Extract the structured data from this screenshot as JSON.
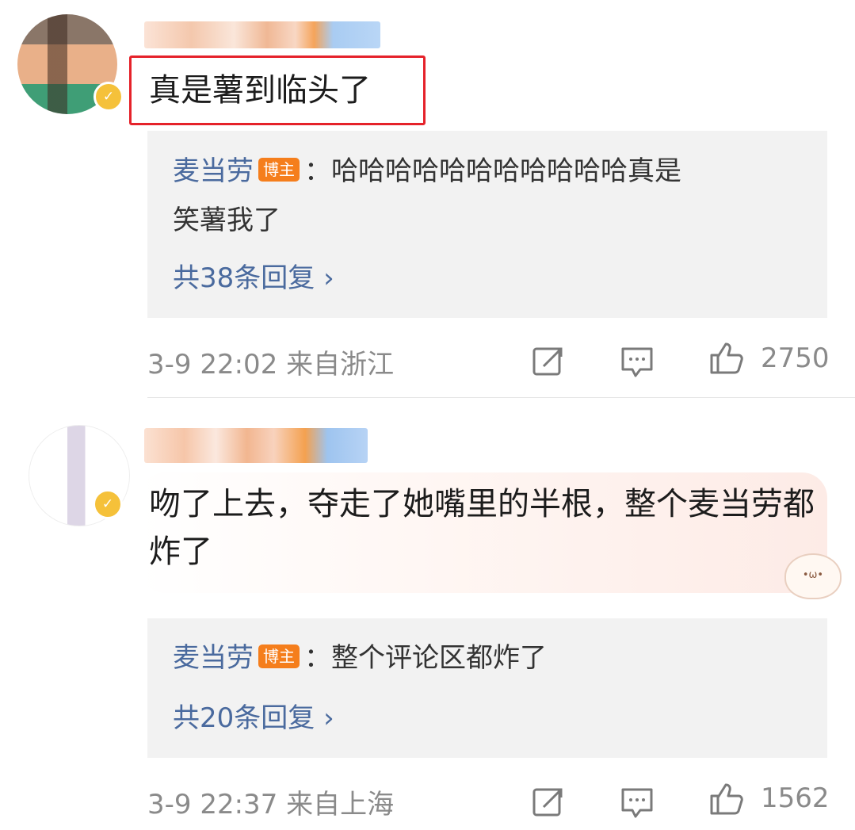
{
  "comments": [
    {
      "text": "真是薯到临头了",
      "reply": {
        "author": "麦当劳",
        "badge": "博主",
        "text_line1": "：哈哈哈哈哈哈哈哈哈哈哈真是",
        "text_line2": "笑薯我了",
        "more": "共38条回复 ›"
      },
      "time_location": "3-9 22:02  来自浙江",
      "likes": "2750"
    },
    {
      "text": "吻了上去，夺走了她嘴里的半根，整个麦当劳都炸了",
      "reply": {
        "author": "麦当劳",
        "badge": "博主",
        "text_line1": "：整个评论区都炸了",
        "more": "共20条回复 ›"
      },
      "time_location": "3-9 22:37  来自上海",
      "likes": "1562"
    }
  ],
  "colors": {
    "link": "#4a6a9e",
    "badge": "#f57e1c",
    "highlight": "#e5222a",
    "vip": "#f5c13a"
  },
  "icons": [
    "share-icon",
    "comment-icon",
    "like-icon",
    "vip-badge-icon",
    "sticker-icon"
  ]
}
